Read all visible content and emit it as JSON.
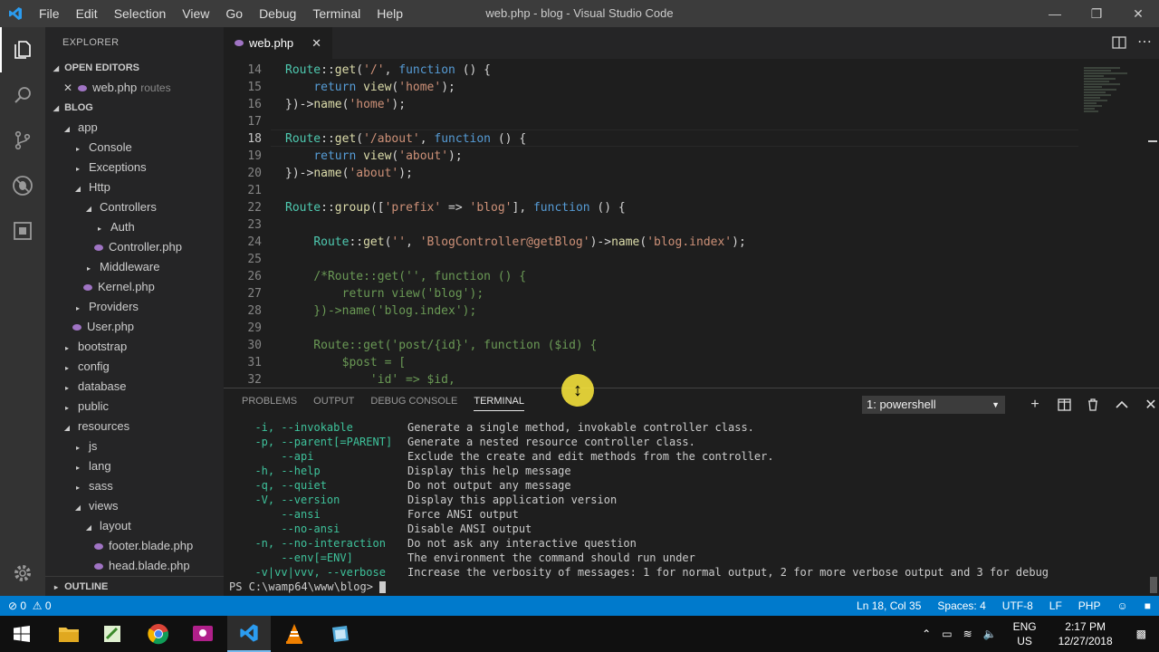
{
  "window": {
    "title": "web.php - blog - Visual Studio Code",
    "controls": [
      "minimize-icon",
      "restore-icon",
      "close-icon"
    ]
  },
  "menu": [
    "File",
    "Edit",
    "Selection",
    "View",
    "Go",
    "Debug",
    "Terminal",
    "Help"
  ],
  "activity": [
    "files-icon",
    "search-icon",
    "source-control-icon",
    "debug-icon",
    "extensions-icon",
    "settings-icon"
  ],
  "sidebar": {
    "title": "EXPLORER",
    "open_editors_label": "OPEN EDITORS",
    "open_file": {
      "name": "web.php",
      "folder": "routes"
    },
    "project_label": "BLOG",
    "outline_label": "OUTLINE",
    "tree": [
      {
        "depth": 0,
        "twistie": "open",
        "label": "app"
      },
      {
        "depth": 1,
        "twistie": "closed",
        "label": "Console"
      },
      {
        "depth": 1,
        "twistie": "closed",
        "label": "Exceptions"
      },
      {
        "depth": 1,
        "twistie": "open",
        "label": "Http"
      },
      {
        "depth": 2,
        "twistie": "open",
        "label": "Controllers"
      },
      {
        "depth": 3,
        "twistie": "closed",
        "label": "Auth"
      },
      {
        "depth": 3,
        "twistie": "php",
        "label": "Controller.php"
      },
      {
        "depth": 2,
        "twistie": "closed",
        "label": "Middleware"
      },
      {
        "depth": 2,
        "twistie": "php",
        "label": "Kernel.php"
      },
      {
        "depth": 1,
        "twistie": "closed",
        "label": "Providers"
      },
      {
        "depth": 1,
        "twistie": "php",
        "label": "User.php"
      },
      {
        "depth": 0,
        "twistie": "closed",
        "label": "bootstrap"
      },
      {
        "depth": 0,
        "twistie": "closed",
        "label": "config"
      },
      {
        "depth": 0,
        "twistie": "closed",
        "label": "database"
      },
      {
        "depth": 0,
        "twistie": "closed",
        "label": "public"
      },
      {
        "depth": 0,
        "twistie": "open",
        "label": "resources"
      },
      {
        "depth": 1,
        "twistie": "closed",
        "label": "js"
      },
      {
        "depth": 1,
        "twistie": "closed",
        "label": "lang"
      },
      {
        "depth": 1,
        "twistie": "closed",
        "label": "sass"
      },
      {
        "depth": 1,
        "twistie": "open",
        "label": "views"
      },
      {
        "depth": 2,
        "twistie": "open",
        "label": "layout"
      },
      {
        "depth": 3,
        "twistie": "php",
        "label": "footer.blade.php"
      },
      {
        "depth": 3,
        "twistie": "php",
        "label": "head.blade.php"
      }
    ]
  },
  "tab": {
    "label": "web.php",
    "close": "✕"
  },
  "editor": {
    "current_line": 18,
    "lines": [
      {
        "n": 14,
        "tokens": [
          [
            "t",
            "Route"
          ],
          [
            "w",
            "::"
          ],
          [
            "f",
            "get"
          ],
          [
            "w",
            "("
          ],
          [
            "s",
            "'/'"
          ],
          [
            "w",
            ", "
          ],
          [
            "k",
            "function"
          ],
          [
            "w",
            " () {"
          ]
        ]
      },
      {
        "n": 15,
        "tokens": [
          [
            "w",
            "    "
          ],
          [
            "k",
            "return"
          ],
          [
            "w",
            " "
          ],
          [
            "f",
            "view"
          ],
          [
            "w",
            "("
          ],
          [
            "s",
            "'home'"
          ],
          [
            "w",
            ");"
          ]
        ]
      },
      {
        "n": 16,
        "tokens": [
          [
            "w",
            "})->"
          ],
          [
            "f",
            "name"
          ],
          [
            "w",
            "("
          ],
          [
            "s",
            "'home'"
          ],
          [
            "w",
            ");"
          ]
        ]
      },
      {
        "n": 17,
        "tokens": []
      },
      {
        "n": 18,
        "tokens": [
          [
            "t",
            "Route"
          ],
          [
            "w",
            "::"
          ],
          [
            "f",
            "get"
          ],
          [
            "w",
            "("
          ],
          [
            "s",
            "'/about'"
          ],
          [
            "w",
            ", "
          ],
          [
            "k",
            "function"
          ],
          [
            "w",
            " () {"
          ]
        ]
      },
      {
        "n": 19,
        "tokens": [
          [
            "w",
            "    "
          ],
          [
            "k",
            "return"
          ],
          [
            "w",
            " "
          ],
          [
            "f",
            "view"
          ],
          [
            "w",
            "("
          ],
          [
            "s",
            "'about'"
          ],
          [
            "w",
            ");"
          ]
        ]
      },
      {
        "n": 20,
        "tokens": [
          [
            "w",
            "})->"
          ],
          [
            "f",
            "name"
          ],
          [
            "w",
            "("
          ],
          [
            "s",
            "'about'"
          ],
          [
            "w",
            ");"
          ]
        ]
      },
      {
        "n": 21,
        "tokens": []
      },
      {
        "n": 22,
        "tokens": [
          [
            "t",
            "Route"
          ],
          [
            "w",
            "::"
          ],
          [
            "f",
            "group"
          ],
          [
            "w",
            "(["
          ],
          [
            "s",
            "'prefix'"
          ],
          [
            "w",
            " => "
          ],
          [
            "s",
            "'blog'"
          ],
          [
            "w",
            "], "
          ],
          [
            "k",
            "function"
          ],
          [
            "w",
            " () {"
          ]
        ]
      },
      {
        "n": 23,
        "tokens": []
      },
      {
        "n": 24,
        "tokens": [
          [
            "w",
            "    "
          ],
          [
            "t",
            "Route"
          ],
          [
            "w",
            "::"
          ],
          [
            "f",
            "get"
          ],
          [
            "w",
            "("
          ],
          [
            "s",
            "''"
          ],
          [
            "w",
            ", "
          ],
          [
            "s",
            "'BlogController@getBlog'"
          ],
          [
            "w",
            ")->"
          ],
          [
            "f",
            "name"
          ],
          [
            "w",
            "("
          ],
          [
            "s",
            "'blog.index'"
          ],
          [
            "w",
            ");"
          ]
        ]
      },
      {
        "n": 25,
        "tokens": []
      },
      {
        "n": 26,
        "tokens": [
          [
            "w",
            "    "
          ],
          [
            "c",
            "/*Route::get('', function () {"
          ]
        ]
      },
      {
        "n": 27,
        "tokens": [
          [
            "c",
            "        return view('blog');"
          ]
        ]
      },
      {
        "n": 28,
        "tokens": [
          [
            "c",
            "    })->name('blog.index');"
          ]
        ]
      },
      {
        "n": 29,
        "tokens": []
      },
      {
        "n": 30,
        "tokens": [
          [
            "c",
            "    Route::get('post/{id}', function ($id) {"
          ]
        ]
      },
      {
        "n": 31,
        "tokens": [
          [
            "c",
            "        $post = ["
          ]
        ]
      },
      {
        "n": 32,
        "tokens": [
          [
            "c",
            "            'id' => $id,"
          ]
        ]
      }
    ]
  },
  "panel": {
    "tabs": [
      "PROBLEMS",
      "OUTPUT",
      "DEBUG CONSOLE",
      "TERMINAL"
    ],
    "active_tab": "TERMINAL",
    "shell": "1: powershell",
    "icons": [
      "plus-icon",
      "split-icon",
      "trash-icon",
      "chevron-up-icon",
      "close-icon"
    ],
    "lines": [
      {
        "opt": "  -i, --invokable",
        "desc": "Generate a single method, invokable controller class."
      },
      {
        "opt": "  -p, --parent[=PARENT]",
        "desc": "Generate a nested resource controller class."
      },
      {
        "opt": "      --api",
        "desc": "Exclude the create and edit methods from the controller."
      },
      {
        "opt": "  -h, --help",
        "desc": "Display this help message"
      },
      {
        "opt": "  -q, --quiet",
        "desc": "Do not output any message"
      },
      {
        "opt": "  -V, --version",
        "desc": "Display this application version"
      },
      {
        "opt": "      --ansi",
        "desc": "Force ANSI output"
      },
      {
        "opt": "      --no-ansi",
        "desc": "Disable ANSI output"
      },
      {
        "opt": "  -n, --no-interaction",
        "desc": "Do not ask any interactive question"
      },
      {
        "opt": "      --env[=ENV]",
        "desc": "The environment the command should run under"
      },
      {
        "opt": "  -v|vv|vvv, --verbose",
        "desc": "Increase the verbosity of messages: 1 for normal output, 2 for more verbose output and 3 for debug"
      }
    ],
    "prompt": "PS C:\\wamp64\\www\\blog>"
  },
  "status": {
    "errors": "0",
    "warnings": "0",
    "position": "Ln 18, Col 35",
    "spaces": "Spaces: 4",
    "encoding": "UTF-8",
    "eol": "LF",
    "language": "PHP"
  },
  "taskbar": {
    "lang": "ENG",
    "region": "US",
    "time": "2:17 PM",
    "date": "12/27/2018"
  }
}
